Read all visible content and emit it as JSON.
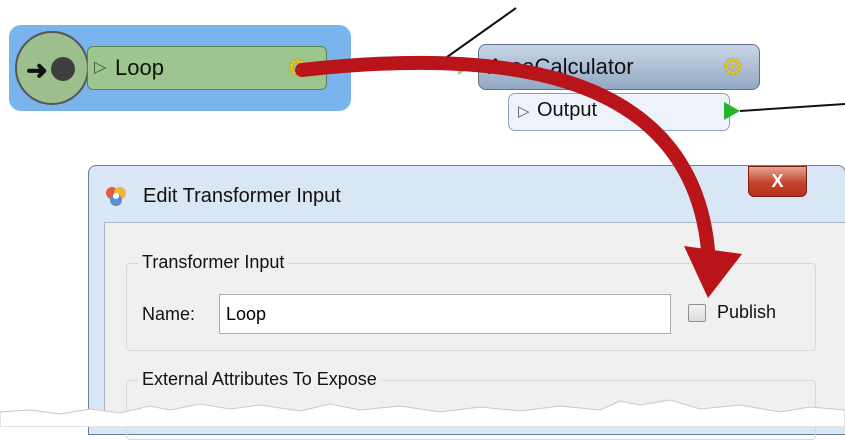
{
  "canvas": {
    "loop_node": {
      "label": "Loop",
      "icon": "gear-icon"
    },
    "area_node": {
      "label": "AreaCalculator",
      "icon": "gear-icon"
    },
    "output_port": {
      "label": "Output"
    },
    "annotation": {
      "icon": "red-curved-arrow-icon",
      "color": "#c0151b"
    }
  },
  "dialog": {
    "title": "Edit Transformer Input",
    "close_label": "X",
    "section_input": {
      "title": "Transformer Input",
      "name_label": "Name:",
      "name_value": "Loop",
      "publish_label": "Publish",
      "publish_checked": false
    },
    "section_attributes": {
      "title": "External Attributes To Expose"
    }
  },
  "colors": {
    "selection": "#7ab4ec",
    "loop_node": "#9cc68d",
    "area_node": "#93a8c3",
    "output_port": "#27b527",
    "close_button": "#c4432c"
  }
}
